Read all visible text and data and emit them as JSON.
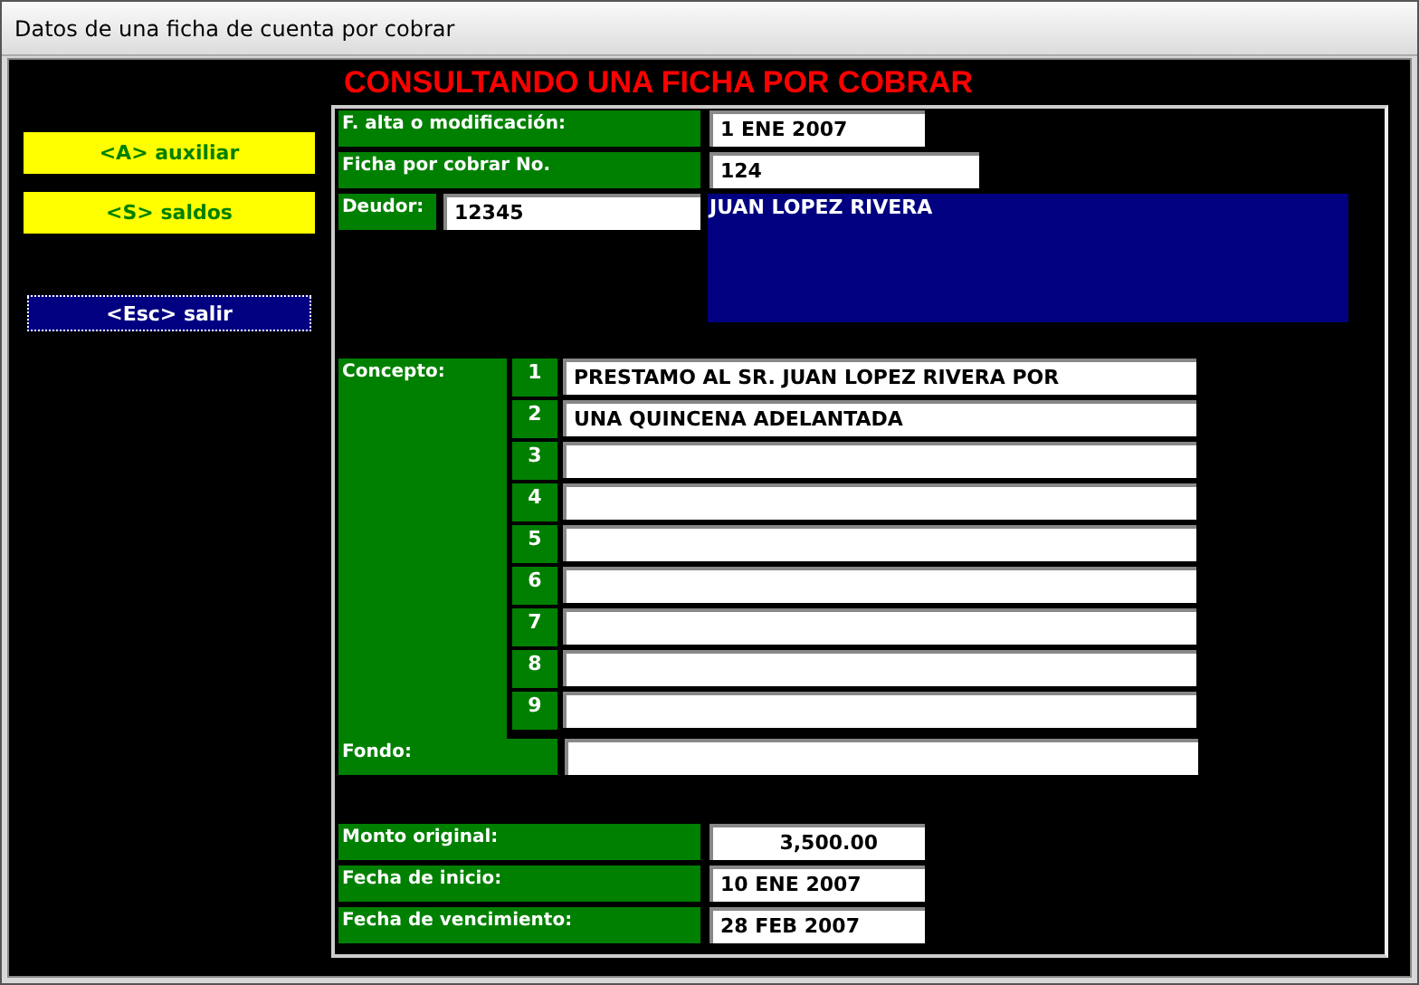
{
  "window": {
    "title": "Datos de una ficha de cuenta por cobrar"
  },
  "sidebar": {
    "buttons": [
      {
        "label": "<A> auxiliar",
        "kind": "highlight"
      },
      {
        "label": "<S> saldos",
        "kind": "highlight"
      },
      {
        "label": "<Esc> salir",
        "kind": "focused"
      }
    ]
  },
  "heading": "CONSULTANDO UNA FICHA POR COBRAR",
  "fecha_alta": {
    "label": "F. alta o modificación:",
    "value": "1 ENE 2007"
  },
  "ficha_no": {
    "label": "Ficha por cobrar No.",
    "value": "124"
  },
  "deudor": {
    "label": "Deudor:",
    "value": "12345",
    "name": "JUAN LOPEZ RIVERA"
  },
  "concepto": {
    "label": "Concepto:",
    "lines": [
      {
        "number": "1",
        "value": "PRESTAMO AL SR. JUAN LOPEZ RIVERA POR"
      },
      {
        "number": "2",
        "value": "UNA QUINCENA ADELANTADA"
      },
      {
        "number": "3"
      },
      {
        "number": "4"
      },
      {
        "number": "5"
      },
      {
        "number": "6"
      },
      {
        "number": "7"
      },
      {
        "number": "8"
      },
      {
        "number": "9"
      }
    ]
  },
  "fondo": {
    "label": "Fondo:"
  },
  "monto_original": {
    "label": "Monto original:",
    "value": "3,500.00"
  },
  "fecha_inicio": {
    "label": "Fecha de inicio:",
    "value": "10 ENE 2007"
  },
  "fecha_vencimiento": {
    "label": "Fecha de vencimiento:",
    "value": "28 FEB 2007"
  }
}
